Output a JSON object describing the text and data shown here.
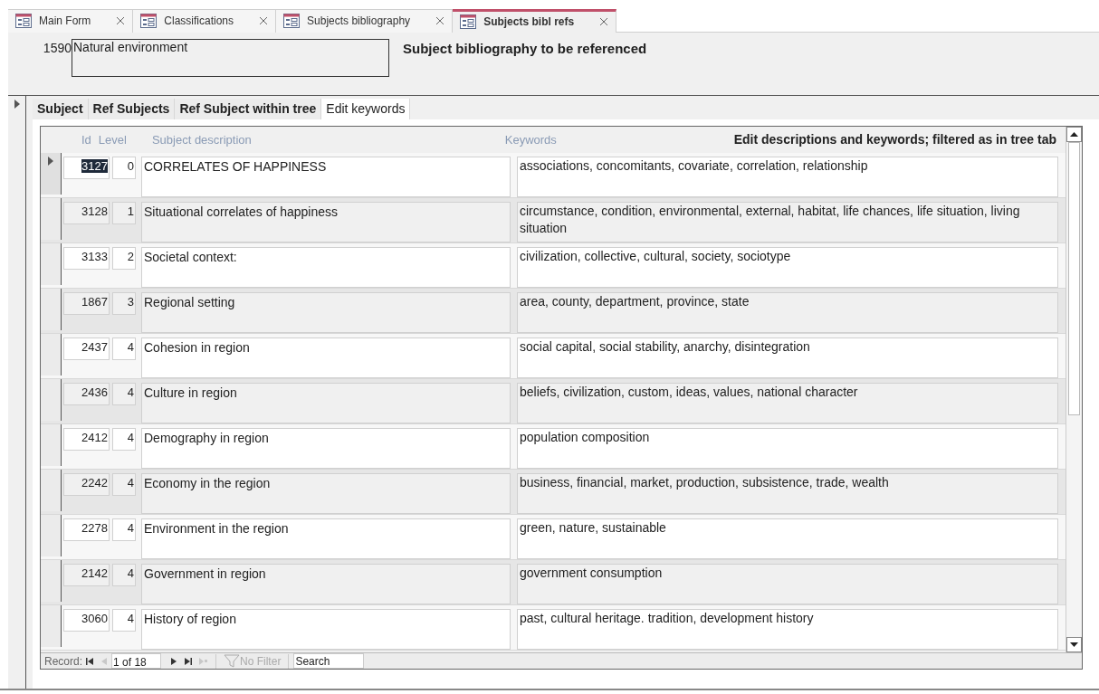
{
  "document_tabs": [
    {
      "label": "Main Form",
      "selected": false
    },
    {
      "label": "Classifications",
      "selected": false
    },
    {
      "label": "Subjects bibliography",
      "selected": false
    },
    {
      "label": "Subjects bibl refs",
      "selected": true
    }
  ],
  "header": {
    "id": "1590",
    "name": "Natural environment",
    "title": "Subject bibliography to be referenced"
  },
  "form_tabs": [
    {
      "label": "Subject",
      "selected": false
    },
    {
      "label": "Ref Subjects",
      "selected": false
    },
    {
      "label": "Ref Subject within tree",
      "selected": false
    },
    {
      "label": "Edit keywords",
      "selected": true
    }
  ],
  "subform": {
    "columns": [
      "Id",
      "Level",
      "Subject description",
      "Keywords"
    ],
    "caption": "Edit descriptions and keywords; filtered as in tree tab",
    "rows": [
      {
        "id": "3127",
        "level": "0",
        "description": "CORRELATES OF HAPPINESS",
        "keywords": "associations, concomitants, covariate, correlation, relationship",
        "current": true
      },
      {
        "id": "3128",
        "level": "1",
        "description": "Situational correlates of happiness",
        "keywords": "circumstance, condition, environmental, external, habitat,  life chances, life situation, living situation",
        "current": false
      },
      {
        "id": "3133",
        "level": "2",
        "description": "Societal context:",
        "keywords": "civilization, collective,  cultural, society, sociotype",
        "current": false
      },
      {
        "id": "1867",
        "level": "3",
        "description": "Regional setting",
        "keywords": "area, county, department, province, state",
        "current": false
      },
      {
        "id": "2437",
        "level": "4",
        "description": "Cohesion in region",
        "keywords": "social capital, social stability, anarchy, disintegration",
        "current": false
      },
      {
        "id": "2436",
        "level": "4",
        "description": "Culture in region",
        "keywords": "beliefs, civilization, custom, ideas, values, national character",
        "current": false
      },
      {
        "id": "2412",
        "level": "4",
        "description": "Demography in region",
        "keywords": "population composition",
        "current": false
      },
      {
        "id": "2242",
        "level": "4",
        "description": "Economy in the region",
        "keywords": "business, financial, market, production, subsistence, trade, wealth",
        "current": false
      },
      {
        "id": "2278",
        "level": "4",
        "description": "Environment in the region",
        "keywords": "green, nature, sustainable",
        "current": false
      },
      {
        "id": "2142",
        "level": "4",
        "description": "Government in region",
        "keywords": "government consumption",
        "current": false
      },
      {
        "id": "3060",
        "level": "4",
        "description": "History of region",
        "keywords": "past, cultural heritage. tradition, development history",
        "current": false
      }
    ]
  },
  "record_nav": {
    "label": "Record:",
    "position": "1 of 18",
    "first_disabled": false,
    "prev_disabled": true,
    "next_disabled": false,
    "last_disabled": false,
    "new_disabled": true,
    "filter": "No Filter",
    "filter_active": false,
    "search_placeholder": "Search"
  }
}
